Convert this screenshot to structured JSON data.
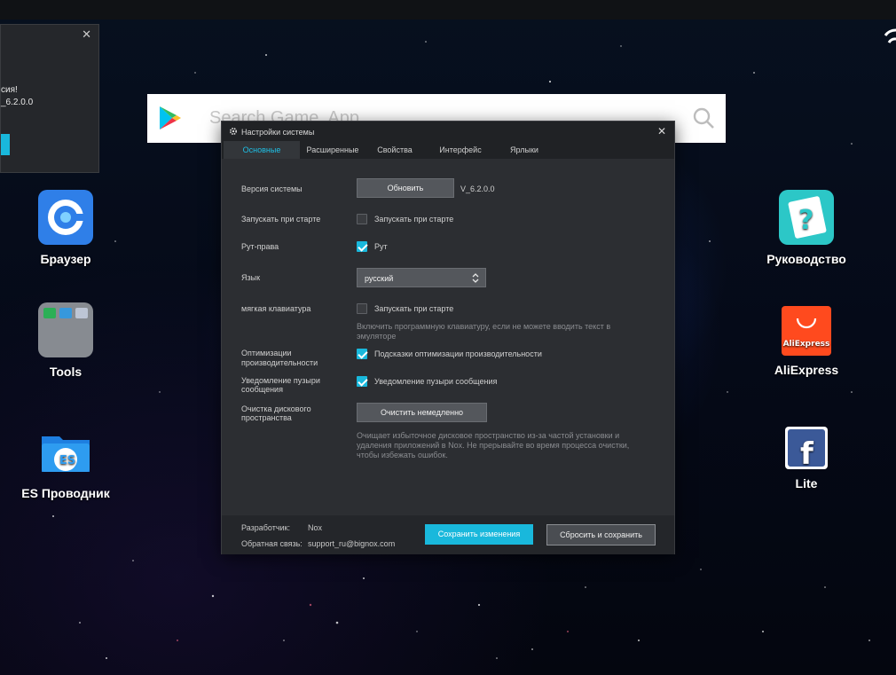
{
  "search": {
    "placeholder": "Search Game, App"
  },
  "notification": {
    "line1": "сия!",
    "line2": "_6.2.0.0"
  },
  "desktop": {
    "left_apps": [
      {
        "label": "Браузер"
      },
      {
        "label": "Tools"
      },
      {
        "label": "ES Проводник"
      }
    ],
    "right_apps": [
      {
        "label": "Руководство"
      },
      {
        "label": "AliExpress",
        "badge": "AliExpress"
      },
      {
        "label": "Lite"
      }
    ]
  },
  "dialog": {
    "title": "Настройки системы",
    "tabs": [
      "Основные",
      "Расширенные",
      "Свойства",
      "Интерфейс",
      "Ярлыки"
    ],
    "active_tab": "Основные",
    "version_label": "Версия системы",
    "update_button": "Обновить",
    "version_value": "V_6.2.0.0",
    "autostart_label": "Запускать при старте",
    "autostart_checkbox": "Запускать при старте",
    "autostart_checked": false,
    "root_label": "Рут-права",
    "root_checkbox": "Рут",
    "root_checked": true,
    "language_label": "Язык",
    "language_value": "русский",
    "keyboard_label": "мягкая клавиатура",
    "keyboard_checkbox": "Запускать при старте",
    "keyboard_checked": false,
    "keyboard_hint_1": "Включить программную клавиатуру, если не можете вводить текст в",
    "keyboard_hint_2": "эмуляторе",
    "perf_label_1": "Оптимизации",
    "perf_label_2": "производительности",
    "perf_checkbox": "Подсказки оптимизации производительности",
    "perf_checked": true,
    "bubble_label_1": "Уведомление пузыри",
    "bubble_label_2": "сообщения",
    "bubble_checkbox": "Уведомление пузыри сообщения",
    "bubble_checked": true,
    "disk_label_1": "Очистка дискового",
    "disk_label_2": "пространства",
    "clean_button": "Очистить немедленно",
    "disk_hint_1": "Очищает избыточное дисковое пространство из-за частой установки и",
    "disk_hint_2": "удаления приложений в Nox. Не прерывайте во время процесса очистки,",
    "disk_hint_3": "чтобы избежать ошибок.",
    "developer_label": "Разработчик:",
    "developer_value": "Nox",
    "feedback_label": "Обратная связь:",
    "feedback_value": "support_ru@bignox.com",
    "save_button": "Сохранить изменения",
    "reset_button": "Сбросить и сохранить"
  },
  "colors": {
    "accent": "#19b8dc",
    "dialog_bg": "#2c2e32",
    "header_bg": "#202225"
  }
}
